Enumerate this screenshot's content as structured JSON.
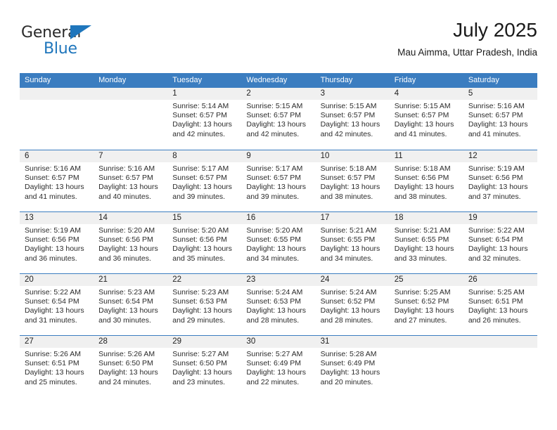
{
  "brand": {
    "name_top": "General",
    "name_bottom": "Blue",
    "accent_color": "#1f76bc"
  },
  "header": {
    "title": "July 2025",
    "subtitle": "Mau Aimma, Uttar Pradesh, India"
  },
  "calendar": {
    "header_bg": "#3b7dc0",
    "daynum_bg": "#f0f0f0",
    "weekdays": [
      "Sunday",
      "Monday",
      "Tuesday",
      "Wednesday",
      "Thursday",
      "Friday",
      "Saturday"
    ],
    "weeks": [
      [
        {
          "day": ""
        },
        {
          "day": ""
        },
        {
          "day": "1",
          "sunrise": "Sunrise: 5:14 AM",
          "sunset": "Sunset: 6:57 PM",
          "daylight_line1": "Daylight: 13 hours",
          "daylight_line2": "and 42 minutes."
        },
        {
          "day": "2",
          "sunrise": "Sunrise: 5:15 AM",
          "sunset": "Sunset: 6:57 PM",
          "daylight_line1": "Daylight: 13 hours",
          "daylight_line2": "and 42 minutes."
        },
        {
          "day": "3",
          "sunrise": "Sunrise: 5:15 AM",
          "sunset": "Sunset: 6:57 PM",
          "daylight_line1": "Daylight: 13 hours",
          "daylight_line2": "and 42 minutes."
        },
        {
          "day": "4",
          "sunrise": "Sunrise: 5:15 AM",
          "sunset": "Sunset: 6:57 PM",
          "daylight_line1": "Daylight: 13 hours",
          "daylight_line2": "and 41 minutes."
        },
        {
          "day": "5",
          "sunrise": "Sunrise: 5:16 AM",
          "sunset": "Sunset: 6:57 PM",
          "daylight_line1": "Daylight: 13 hours",
          "daylight_line2": "and 41 minutes."
        }
      ],
      [
        {
          "day": "6",
          "sunrise": "Sunrise: 5:16 AM",
          "sunset": "Sunset: 6:57 PM",
          "daylight_line1": "Daylight: 13 hours",
          "daylight_line2": "and 41 minutes."
        },
        {
          "day": "7",
          "sunrise": "Sunrise: 5:16 AM",
          "sunset": "Sunset: 6:57 PM",
          "daylight_line1": "Daylight: 13 hours",
          "daylight_line2": "and 40 minutes."
        },
        {
          "day": "8",
          "sunrise": "Sunrise: 5:17 AM",
          "sunset": "Sunset: 6:57 PM",
          "daylight_line1": "Daylight: 13 hours",
          "daylight_line2": "and 39 minutes."
        },
        {
          "day": "9",
          "sunrise": "Sunrise: 5:17 AM",
          "sunset": "Sunset: 6:57 PM",
          "daylight_line1": "Daylight: 13 hours",
          "daylight_line2": "and 39 minutes."
        },
        {
          "day": "10",
          "sunrise": "Sunrise: 5:18 AM",
          "sunset": "Sunset: 6:57 PM",
          "daylight_line1": "Daylight: 13 hours",
          "daylight_line2": "and 38 minutes."
        },
        {
          "day": "11",
          "sunrise": "Sunrise: 5:18 AM",
          "sunset": "Sunset: 6:56 PM",
          "daylight_line1": "Daylight: 13 hours",
          "daylight_line2": "and 38 minutes."
        },
        {
          "day": "12",
          "sunrise": "Sunrise: 5:19 AM",
          "sunset": "Sunset: 6:56 PM",
          "daylight_line1": "Daylight: 13 hours",
          "daylight_line2": "and 37 minutes."
        }
      ],
      [
        {
          "day": "13",
          "sunrise": "Sunrise: 5:19 AM",
          "sunset": "Sunset: 6:56 PM",
          "daylight_line1": "Daylight: 13 hours",
          "daylight_line2": "and 36 minutes."
        },
        {
          "day": "14",
          "sunrise": "Sunrise: 5:20 AM",
          "sunset": "Sunset: 6:56 PM",
          "daylight_line1": "Daylight: 13 hours",
          "daylight_line2": "and 36 minutes."
        },
        {
          "day": "15",
          "sunrise": "Sunrise: 5:20 AM",
          "sunset": "Sunset: 6:56 PM",
          "daylight_line1": "Daylight: 13 hours",
          "daylight_line2": "and 35 minutes."
        },
        {
          "day": "16",
          "sunrise": "Sunrise: 5:20 AM",
          "sunset": "Sunset: 6:55 PM",
          "daylight_line1": "Daylight: 13 hours",
          "daylight_line2": "and 34 minutes."
        },
        {
          "day": "17",
          "sunrise": "Sunrise: 5:21 AM",
          "sunset": "Sunset: 6:55 PM",
          "daylight_line1": "Daylight: 13 hours",
          "daylight_line2": "and 34 minutes."
        },
        {
          "day": "18",
          "sunrise": "Sunrise: 5:21 AM",
          "sunset": "Sunset: 6:55 PM",
          "daylight_line1": "Daylight: 13 hours",
          "daylight_line2": "and 33 minutes."
        },
        {
          "day": "19",
          "sunrise": "Sunrise: 5:22 AM",
          "sunset": "Sunset: 6:54 PM",
          "daylight_line1": "Daylight: 13 hours",
          "daylight_line2": "and 32 minutes."
        }
      ],
      [
        {
          "day": "20",
          "sunrise": "Sunrise: 5:22 AM",
          "sunset": "Sunset: 6:54 PM",
          "daylight_line1": "Daylight: 13 hours",
          "daylight_line2": "and 31 minutes."
        },
        {
          "day": "21",
          "sunrise": "Sunrise: 5:23 AM",
          "sunset": "Sunset: 6:54 PM",
          "daylight_line1": "Daylight: 13 hours",
          "daylight_line2": "and 30 minutes."
        },
        {
          "day": "22",
          "sunrise": "Sunrise: 5:23 AM",
          "sunset": "Sunset: 6:53 PM",
          "daylight_line1": "Daylight: 13 hours",
          "daylight_line2": "and 29 minutes."
        },
        {
          "day": "23",
          "sunrise": "Sunrise: 5:24 AM",
          "sunset": "Sunset: 6:53 PM",
          "daylight_line1": "Daylight: 13 hours",
          "daylight_line2": "and 28 minutes."
        },
        {
          "day": "24",
          "sunrise": "Sunrise: 5:24 AM",
          "sunset": "Sunset: 6:52 PM",
          "daylight_line1": "Daylight: 13 hours",
          "daylight_line2": "and 28 minutes."
        },
        {
          "day": "25",
          "sunrise": "Sunrise: 5:25 AM",
          "sunset": "Sunset: 6:52 PM",
          "daylight_line1": "Daylight: 13 hours",
          "daylight_line2": "and 27 minutes."
        },
        {
          "day": "26",
          "sunrise": "Sunrise: 5:25 AM",
          "sunset": "Sunset: 6:51 PM",
          "daylight_line1": "Daylight: 13 hours",
          "daylight_line2": "and 26 minutes."
        }
      ],
      [
        {
          "day": "27",
          "sunrise": "Sunrise: 5:26 AM",
          "sunset": "Sunset: 6:51 PM",
          "daylight_line1": "Daylight: 13 hours",
          "daylight_line2": "and 25 minutes."
        },
        {
          "day": "28",
          "sunrise": "Sunrise: 5:26 AM",
          "sunset": "Sunset: 6:50 PM",
          "daylight_line1": "Daylight: 13 hours",
          "daylight_line2": "and 24 minutes."
        },
        {
          "day": "29",
          "sunrise": "Sunrise: 5:27 AM",
          "sunset": "Sunset: 6:50 PM",
          "daylight_line1": "Daylight: 13 hours",
          "daylight_line2": "and 23 minutes."
        },
        {
          "day": "30",
          "sunrise": "Sunrise: 5:27 AM",
          "sunset": "Sunset: 6:49 PM",
          "daylight_line1": "Daylight: 13 hours",
          "daylight_line2": "and 22 minutes."
        },
        {
          "day": "31",
          "sunrise": "Sunrise: 5:28 AM",
          "sunset": "Sunset: 6:49 PM",
          "daylight_line1": "Daylight: 13 hours",
          "daylight_line2": "and 20 minutes."
        },
        {
          "day": ""
        },
        {
          "day": ""
        }
      ]
    ]
  }
}
